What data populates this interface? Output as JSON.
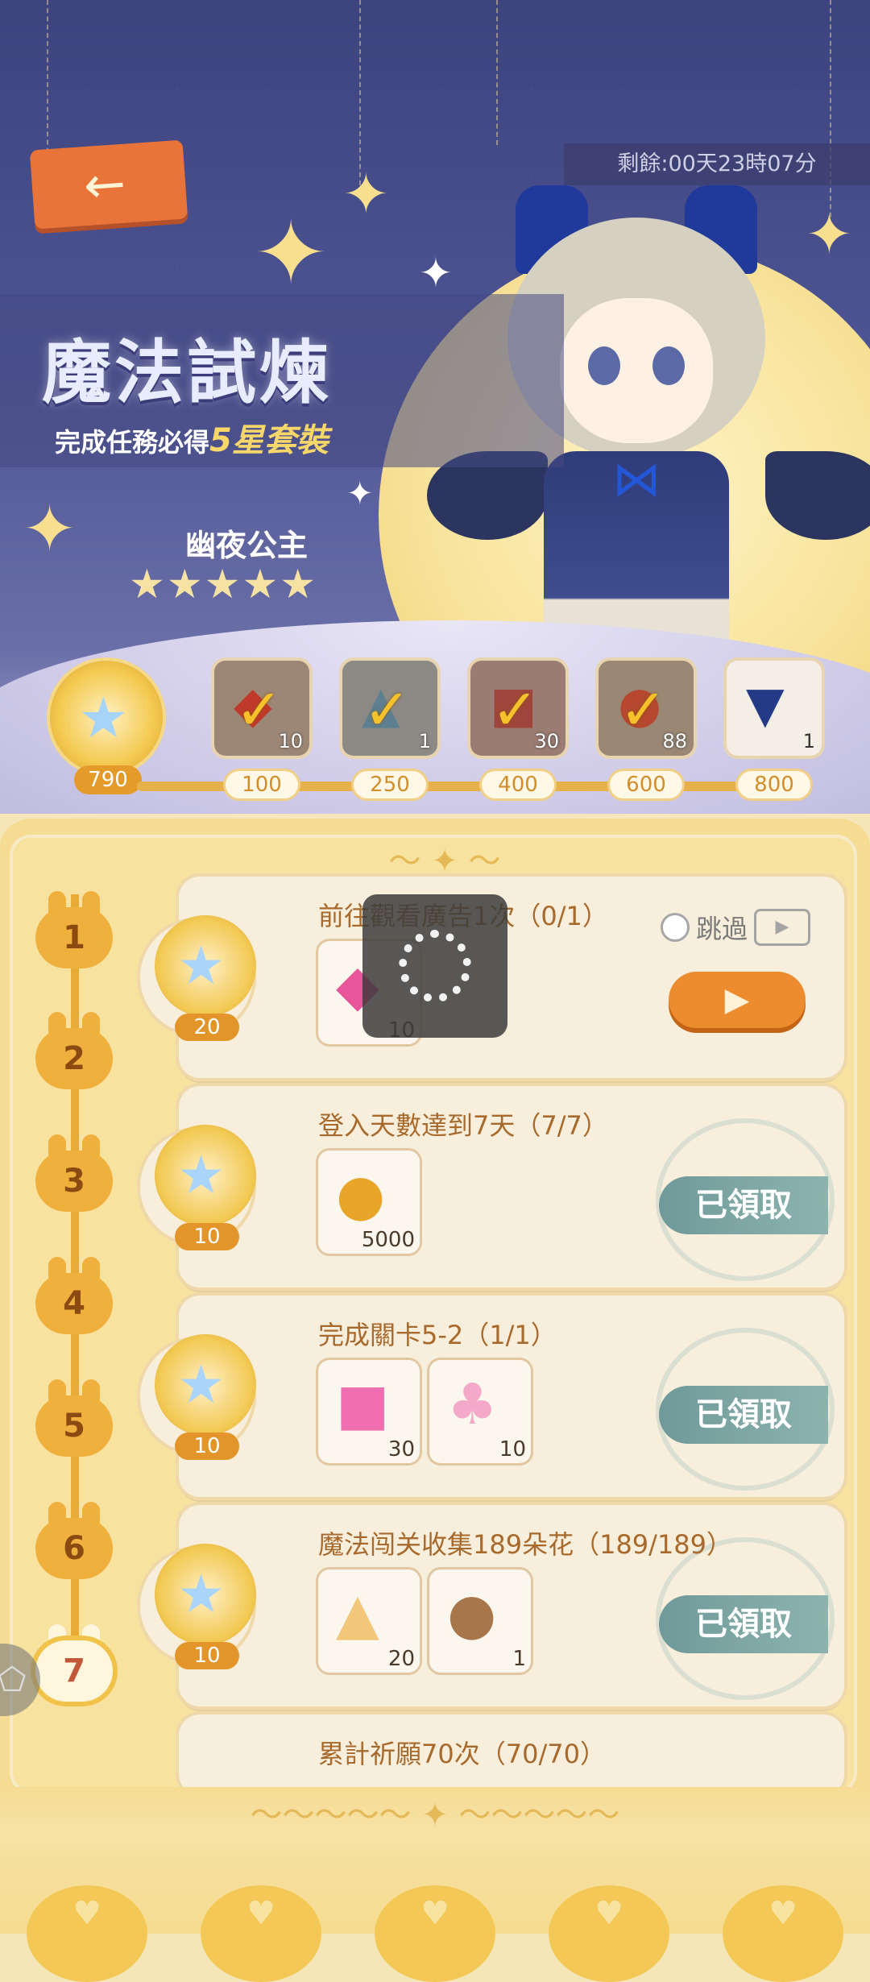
{
  "header": {
    "timer": "剩餘:00天23時07分",
    "title": "魔法試煉",
    "subtitle_prefix": "完成任務必得",
    "subtitle_highlight": "5星套裝",
    "character_name": "幽夜公主",
    "rating": "★★★★★"
  },
  "icons": {
    "back": "←",
    "gem": "★",
    "check": "✓",
    "coin": "●",
    "video": "▶"
  },
  "progress": {
    "current_points": "790",
    "fill_fraction": 0.96,
    "milestones": [
      {
        "threshold": "100",
        "qty": "10",
        "claimed": true
      },
      {
        "threshold": "250",
        "qty": "1",
        "claimed": true
      },
      {
        "threshold": "400",
        "qty": "30",
        "claimed": true
      },
      {
        "threshold": "600",
        "qty": "88",
        "claimed": true
      },
      {
        "threshold": "800",
        "qty": "1",
        "claimed": false
      }
    ]
  },
  "steps": [
    "1",
    "2",
    "3",
    "4",
    "5",
    "6",
    "7"
  ],
  "quests": [
    {
      "title": "前往觀看廣告1次（0/1）",
      "reward_qty": "20",
      "items": [
        {
          "qty": "10"
        }
      ],
      "skip_label": "跳過",
      "status": "video"
    },
    {
      "title": "登入天數達到7天（7/7）",
      "reward_qty": "10",
      "items": [
        {
          "qty": "5000"
        }
      ],
      "status_label": "已領取"
    },
    {
      "title": "完成關卡5-2（1/1）",
      "reward_qty": "10",
      "items": [
        {
          "qty": "30"
        },
        {
          "qty": "10"
        }
      ],
      "status_label": "已領取"
    },
    {
      "title": "魔法闯关收集189朵花（189/189）",
      "reward_qty": "10",
      "items": [
        {
          "qty": "20"
        },
        {
          "qty": "1"
        }
      ],
      "status_label": "已領取"
    },
    {
      "title": "累計祈願70次（70/70）",
      "reward_qty": "",
      "items": [],
      "status_label": ""
    }
  ],
  "colors": {
    "accent_orange": "#ed8b2f",
    "claimed_teal": "#6f9a9a",
    "panel_yellow": "#f6dc93",
    "banner_navy": "#3d437d"
  }
}
